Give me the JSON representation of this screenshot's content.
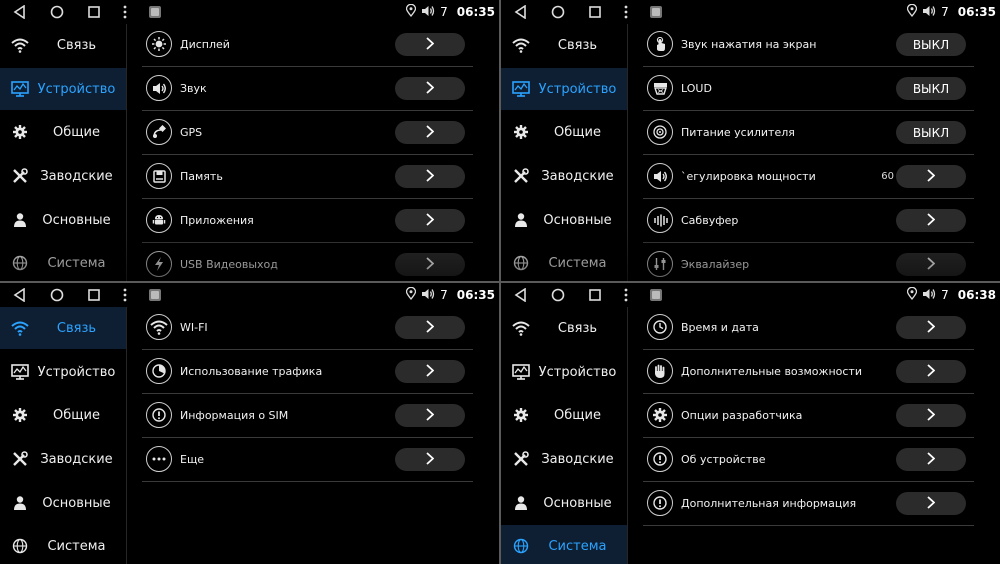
{
  "colors": {
    "accent": "#2ba3ff",
    "active_bg": "#0e1f33",
    "button_bg": "#2b2b2b",
    "divider": "#3a3a3a"
  },
  "panels": [
    {
      "status": {
        "volume": "7",
        "time": "06:35"
      },
      "active_item": 1,
      "sidebar": [
        {
          "label": "Связь",
          "icon": "wifi-icon"
        },
        {
          "label": "Устройство",
          "icon": "device-icon"
        },
        {
          "label": "Общие",
          "icon": "gear-icon"
        },
        {
          "label": "Заводские",
          "icon": "tools-icon"
        },
        {
          "label": "Основные",
          "icon": "user-icon"
        },
        {
          "label": "Система",
          "icon": "globe-icon"
        }
      ],
      "rows": [
        {
          "label": "Дисплей",
          "icon": "brightness-icon",
          "control": "",
          "value": ""
        },
        {
          "label": "Звук",
          "icon": "speaker-icon",
          "control": "",
          "value": ""
        },
        {
          "label": "GPS",
          "icon": "satellite-icon",
          "control": "",
          "value": ""
        },
        {
          "label": "Память",
          "icon": "storage-icon",
          "control": "",
          "value": ""
        },
        {
          "label": "Приложения",
          "icon": "android-icon",
          "control": "",
          "value": ""
        },
        {
          "label": "USB Видеовыход",
          "icon": "bolt-icon",
          "control": "",
          "value": ""
        }
      ]
    },
    {
      "status": {
        "volume": "7",
        "time": "06:35"
      },
      "active_item": 1,
      "sidebar": [
        {
          "label": "Связь",
          "icon": "wifi-icon"
        },
        {
          "label": "Устройство",
          "icon": "device-icon"
        },
        {
          "label": "Общие",
          "icon": "gear-icon"
        },
        {
          "label": "Заводские",
          "icon": "tools-icon"
        },
        {
          "label": "Основные",
          "icon": "user-icon"
        },
        {
          "label": "Система",
          "icon": "globe-icon"
        }
      ],
      "rows": [
        {
          "label": "Звук нажатия на экран",
          "icon": "touch-icon",
          "control": "ВЫКЛ",
          "value": ""
        },
        {
          "label": "LOUD",
          "icon": "loud-icon",
          "control": "ВЫКЛ",
          "value": ""
        },
        {
          "label": "Питание усилителя",
          "icon": "amplifier-icon",
          "control": "ВЫКЛ",
          "value": ""
        },
        {
          "label": "`егулировка мощности",
          "icon": "speaker-icon",
          "control": "",
          "value": "60"
        },
        {
          "label": "Сабвуфер",
          "icon": "subwoofer-icon",
          "control": "",
          "value": ""
        },
        {
          "label": "Эквалайзер",
          "icon": "equalizer-icon",
          "control": "",
          "value": ""
        }
      ]
    },
    {
      "status": {
        "volume": "7",
        "time": "06:35"
      },
      "active_item": 0,
      "sidebar": [
        {
          "label": "Связь",
          "icon": "wifi-icon"
        },
        {
          "label": "Устройство",
          "icon": "device-icon"
        },
        {
          "label": "Общие",
          "icon": "gear-icon"
        },
        {
          "label": "Заводские",
          "icon": "tools-icon"
        },
        {
          "label": "Основные",
          "icon": "user-icon"
        },
        {
          "label": "Система",
          "icon": "globe-icon"
        }
      ],
      "rows": [
        {
          "label": "WI-FI",
          "icon": "wifi-icon",
          "control": "",
          "value": ""
        },
        {
          "label": "Использование трафика",
          "icon": "pie-icon",
          "control": "",
          "value": ""
        },
        {
          "label": "Информация о SIM",
          "icon": "info-icon",
          "control": "",
          "value": ""
        },
        {
          "label": "Еще",
          "icon": "more-icon",
          "control": "",
          "value": ""
        }
      ]
    },
    {
      "status": {
        "volume": "7",
        "time": "06:38"
      },
      "active_item": 5,
      "sidebar": [
        {
          "label": "Связь",
          "icon": "wifi-icon"
        },
        {
          "label": "Устройство",
          "icon": "device-icon"
        },
        {
          "label": "Общие",
          "icon": "gear-icon"
        },
        {
          "label": "Заводские",
          "icon": "tools-icon"
        },
        {
          "label": "Основные",
          "icon": "user-icon"
        },
        {
          "label": "Система",
          "icon": "globe-icon"
        }
      ],
      "rows": [
        {
          "label": "Время и дата",
          "icon": "clock-icon",
          "control": "",
          "value": ""
        },
        {
          "label": "Дополнительные возможности",
          "icon": "hand-icon",
          "control": "",
          "value": ""
        },
        {
          "label": "Опции разработчика",
          "icon": "gear-icon",
          "control": "",
          "value": ""
        },
        {
          "label": "Об устройстве",
          "icon": "info-icon",
          "control": "",
          "value": ""
        },
        {
          "label": "Дополнительная информация",
          "icon": "info-icon",
          "control": "",
          "value": ""
        }
      ]
    }
  ]
}
